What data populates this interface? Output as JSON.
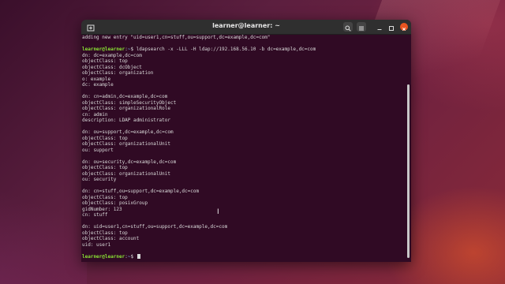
{
  "window": {
    "title": "learner@learner: ~"
  },
  "terminal": {
    "prompt_user": "learner@learner",
    "prompt_path": "~",
    "lines": [
      {
        "type": "out",
        "text": "adding new entry \"uid=user1,cn=stuff,ou=support,dc=example,dc=com\""
      },
      {
        "type": "out",
        "text": ""
      },
      {
        "type": "cmd",
        "text": "ldapsearch -x -LLL -H ldap://192.168.56.10 -b dc=example,dc=com"
      },
      {
        "type": "out",
        "text": "dn: dc=example,dc=com"
      },
      {
        "type": "out",
        "text": "objectClass: top"
      },
      {
        "type": "out",
        "text": "objectClass: dcObject"
      },
      {
        "type": "out",
        "text": "objectClass: organization"
      },
      {
        "type": "out",
        "text": "o: example"
      },
      {
        "type": "out",
        "text": "dc: example"
      },
      {
        "type": "out",
        "text": ""
      },
      {
        "type": "out",
        "text": "dn: cn=admin,dc=example,dc=com"
      },
      {
        "type": "out",
        "text": "objectClass: simpleSecurityObject"
      },
      {
        "type": "out",
        "text": "objectClass: organizationalRole"
      },
      {
        "type": "out",
        "text": "cn: admin"
      },
      {
        "type": "out",
        "text": "description: LDAP administrator"
      },
      {
        "type": "out",
        "text": ""
      },
      {
        "type": "out",
        "text": "dn: ou=support,dc=example,dc=com"
      },
      {
        "type": "out",
        "text": "objectClass: top"
      },
      {
        "type": "out",
        "text": "objectClass: organizationalUnit"
      },
      {
        "type": "out",
        "text": "ou: support"
      },
      {
        "type": "out",
        "text": ""
      },
      {
        "type": "out",
        "text": "dn: ou=security,dc=example,dc=com"
      },
      {
        "type": "out",
        "text": "objectClass: top"
      },
      {
        "type": "out",
        "text": "objectClass: organizationalUnit"
      },
      {
        "type": "out",
        "text": "ou: security"
      },
      {
        "type": "out",
        "text": ""
      },
      {
        "type": "out",
        "text": "dn: cn=stuff,ou=support,dc=example,dc=com"
      },
      {
        "type": "out",
        "text": "objectClass: top"
      },
      {
        "type": "out",
        "text": "objectClass: posixGroup"
      },
      {
        "type": "out",
        "text": "gidNumber: 123"
      },
      {
        "type": "out",
        "text": "cn: stuff"
      },
      {
        "type": "out",
        "text": ""
      },
      {
        "type": "out",
        "text": "dn: uid=user1,cn=stuff,ou=support,dc=example,dc=com"
      },
      {
        "type": "out",
        "text": "objectClass: top"
      },
      {
        "type": "out",
        "text": "objectClass: account"
      },
      {
        "type": "out",
        "text": "uid: user1"
      },
      {
        "type": "out",
        "text": ""
      },
      {
        "type": "cmd",
        "text": ""
      }
    ]
  },
  "colors": {
    "terminal_bg": "#300a24",
    "prompt_user": "#8ae234",
    "prompt_path": "#729fcf",
    "close_button": "#e95420"
  },
  "icons": {
    "new_tab": "new-tab-icon",
    "search": "search-icon",
    "menu": "hamburger-menu-icon",
    "minimize": "minimize-icon",
    "maximize": "maximize-icon",
    "close": "close-icon"
  }
}
